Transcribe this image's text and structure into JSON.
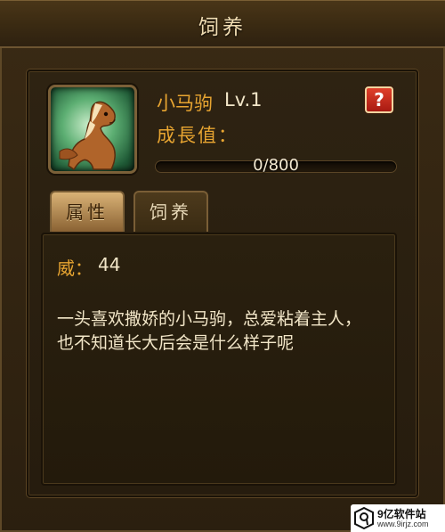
{
  "window": {
    "title": "饲养"
  },
  "pet": {
    "name": "小马驹",
    "level": "Lv.1",
    "growth_label": "成長值：",
    "growth_text": "0/800",
    "growth_progress": 0,
    "help_label": "?"
  },
  "tabs": [
    {
      "label": "属性",
      "active": true
    },
    {
      "label": "饲养",
      "active": false
    }
  ],
  "attributes": {
    "stat_label": "威：",
    "stat_value": "44",
    "description": "一头喜欢撒娇的小马驹，总爱粘着主人，也不知道长大后会是什么样子呢"
  },
  "watermark": {
    "name": "9亿软件站",
    "url": "www.9irjz.com"
  },
  "colors": {
    "accent_gold": "#e8a531",
    "text_cream": "#f2e6c8",
    "help_red": "#c42a1a"
  }
}
